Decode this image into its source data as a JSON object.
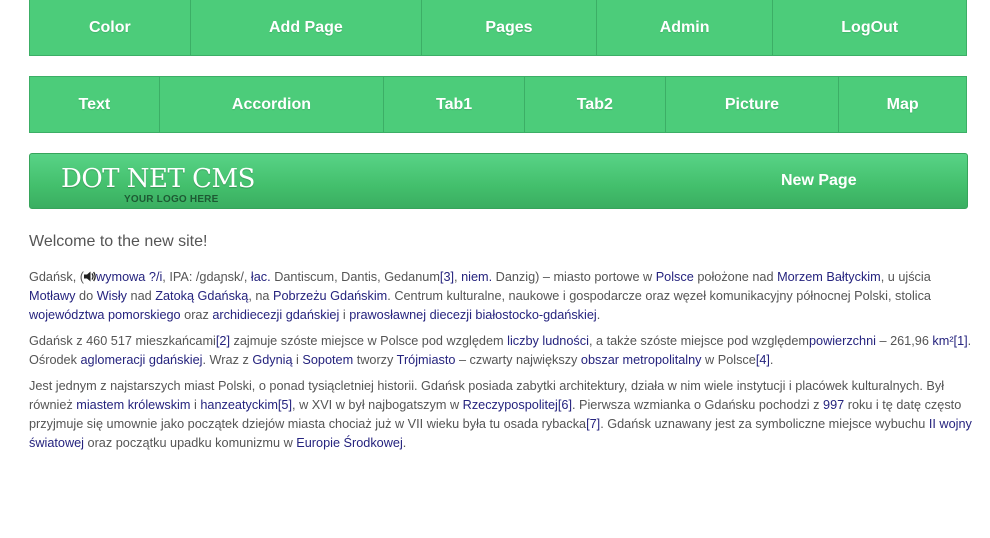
{
  "nav_top": [
    "Color",
    "Add Page",
    "Pages",
    "Admin",
    "LogOut"
  ],
  "nav_second": [
    "Text",
    "Accordion",
    "Tab1",
    "Tab2",
    "Picture",
    "Map"
  ],
  "header": {
    "logo_main": "DOT NET CMS",
    "logo_sub": "YOUR LOGO HERE",
    "link": "New Page"
  },
  "welcome": "Welcome to the new site!",
  "p1": {
    "t0": "Gdańsk, (",
    "l_wymowa": "wymowa",
    "t1": " ",
    "l_q": "?/i",
    "t2": ", IPA: /gdaɲsk/, ",
    "l_lac": "łac.",
    "t3": " Dantiscum, Dantis, Gedanum",
    "l_ref3": "[3]",
    "t4": ", ",
    "l_niem": "niem.",
    "t5": " Danzig) – miasto portowe w ",
    "l_polsce": "Polsce",
    "t6": " położone nad ",
    "l_morzem": "Morzem Bałtyckim",
    "t7": ", u ujścia ",
    "l_motlawy": "Motławy",
    "t8": " do ",
    "l_wisly": "Wisły",
    "t9": " nad ",
    "l_zatoka": "Zatoką Gdańską",
    "t10": ", na ",
    "l_pobrzezu": "Pobrzeżu Gdańskim",
    "t11": ". Centrum kulturalne, naukowe i gospodarcze oraz węzeł komunikacyjny północnej Polski, stolica ",
    "l_woj": "województwa pomorskiego",
    "t12": " oraz ",
    "l_archi": "archidiecezji gdańskiej",
    "t13": " i ",
    "l_prawo": "prawosławnej diecezji białostocko-gdańskiej",
    "t14": "."
  },
  "p2": {
    "t0": "Gdańsk z 460 517 mieszkańcami",
    "l_ref2": "[2]",
    "t1": " zajmuje szóste miejsce w Polsce pod względem ",
    "l_liczby": "liczby ludności",
    "t2": ", a także szóste miejsce pod względem",
    "l_powierzchni": "powierzchni",
    "t3": " – 261,96 ",
    "l_km2": "km²",
    "l_ref1": "[1]",
    "t4": ". Ośrodek ",
    "l_aglomeracji": "aglomeracji gdańskiej",
    "t5": ". Wraz z ",
    "l_gdynia": "Gdynią",
    "t6": " i ",
    "l_sopotem": "Sopotem",
    "t7": " tworzy ",
    "l_trojmiasto": "Trójmiasto",
    "t8": " – czwarty największy ",
    "l_obszar": "obszar metropolitalny",
    "t9": " w Polsce",
    "l_ref4": "[4]",
    "t10": "."
  },
  "p3": {
    "t0": "Jest jednym z najstarszych miast Polski, o ponad tysiącletniej historii. Gdańsk posiada zabytki architektury, działa w nim wiele instytucji i placówek kulturalnych. Był również ",
    "l_miastem": "miastem królewskim",
    "t1": " i ",
    "l_hanzeatyckim": "hanzeatyckim",
    "l_ref5": "[5]",
    "t2": ", w XVI w był najbogatszym w ",
    "l_rzeczy": "Rzeczypospolitej",
    "l_ref6": "[6]",
    "t3": ". Pierwsza wzmianka o Gdańsku pochodzi z ",
    "l_997": "997",
    "t4": " roku i tę datę często przyjmuje się umownie jako początek dziejów miasta chociaż już w VII wieku była tu osada rybacka",
    "l_ref7": "[7]",
    "t5": ". Gdańsk uznawany jest za symboliczne miejsce wybuchu ",
    "l_wojny": "II wojny światowej",
    "t6": " oraz początku upadku komunizmu w ",
    "l_europie": "Europie Środkowej",
    "t7": "."
  }
}
